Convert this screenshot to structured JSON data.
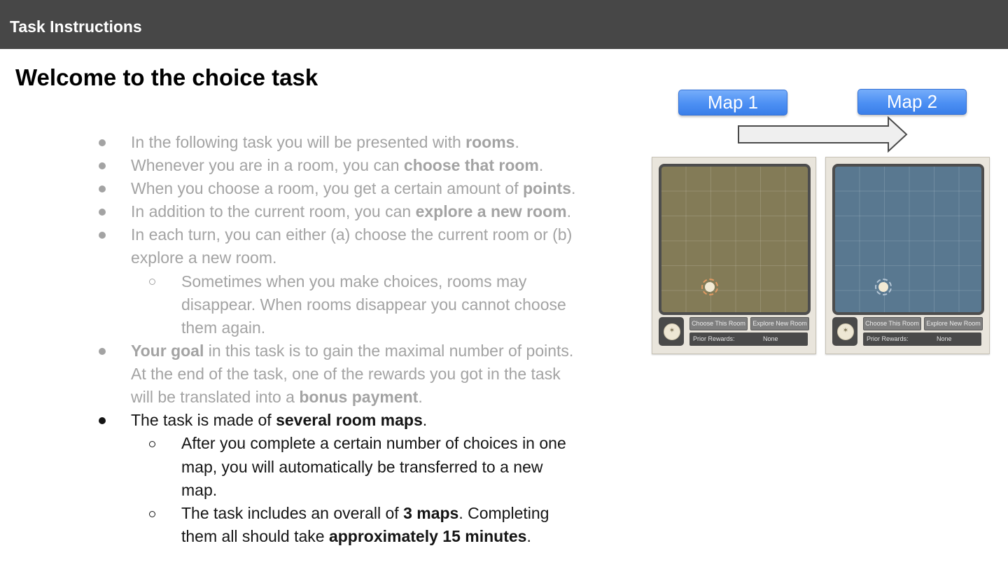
{
  "header": {
    "title": "Task Instructions"
  },
  "heading": "Welcome to the choice task",
  "list": {
    "i1": {
      "t1": "In the following task you will be presented with ",
      "b1": "rooms",
      "t2": "."
    },
    "i2": {
      "t1": "Whenever you are in a room, you can ",
      "b1": "choose that room",
      "t2": "."
    },
    "i3": {
      "t1": "When you choose a room, you get a certain amount of ",
      "b1": "points",
      "t2": "."
    },
    "i4": {
      "t1": "In addition to the current room, you can ",
      "b1": "explore a new room",
      "t2": "."
    },
    "i5": {
      "l1": "In each turn, you can either (a) choose the current room or (b)",
      "l2": "explore a new room."
    },
    "i5a": {
      "l1": "Sometimes when you make choices, rooms may",
      "l2": "disappear. When rooms disappear you cannot choose",
      "l3": "them again."
    },
    "i6": {
      "b1": "Your goal",
      "t1": " in this task is to gain the maximal number of points.",
      "l2": "At the end of the task, one of the rewards you got in the task",
      "l3t": "will be translated into a ",
      "l3b": "bonus payment",
      "l3e": "."
    },
    "i7": {
      "t1": "The task is made of ",
      "b1": "several room maps",
      "t2": "."
    },
    "i7a": {
      "l1": "After you complete a certain number of choices in one",
      "l2": "map,  you will automatically be transferred to a new",
      "l3": "map."
    },
    "i7b": {
      "t1": "The task includes an overall of ",
      "b1": "3 maps",
      "t2": ". Completing",
      "l2t": "them all should take ",
      "l2b": "approximately 15 minutes",
      "l2e": "."
    }
  },
  "figure": {
    "map1_label": "Map 1",
    "map2_label": "Map 2",
    "arrow_icon": "right-arrow-icon",
    "panel_colors": {
      "map1": "#837b57",
      "map2": "#597890"
    },
    "panels": [
      {
        "choose_label": "Choose This Room",
        "explore_label": "Explore New Room",
        "rewards_label": "Prior Rewards:",
        "rewards_value": "None"
      },
      {
        "choose_label": "Choose This Room",
        "explore_label": "Explore New Room",
        "rewards_label": "Prior Rewards:",
        "rewards_value": "None"
      }
    ]
  }
}
